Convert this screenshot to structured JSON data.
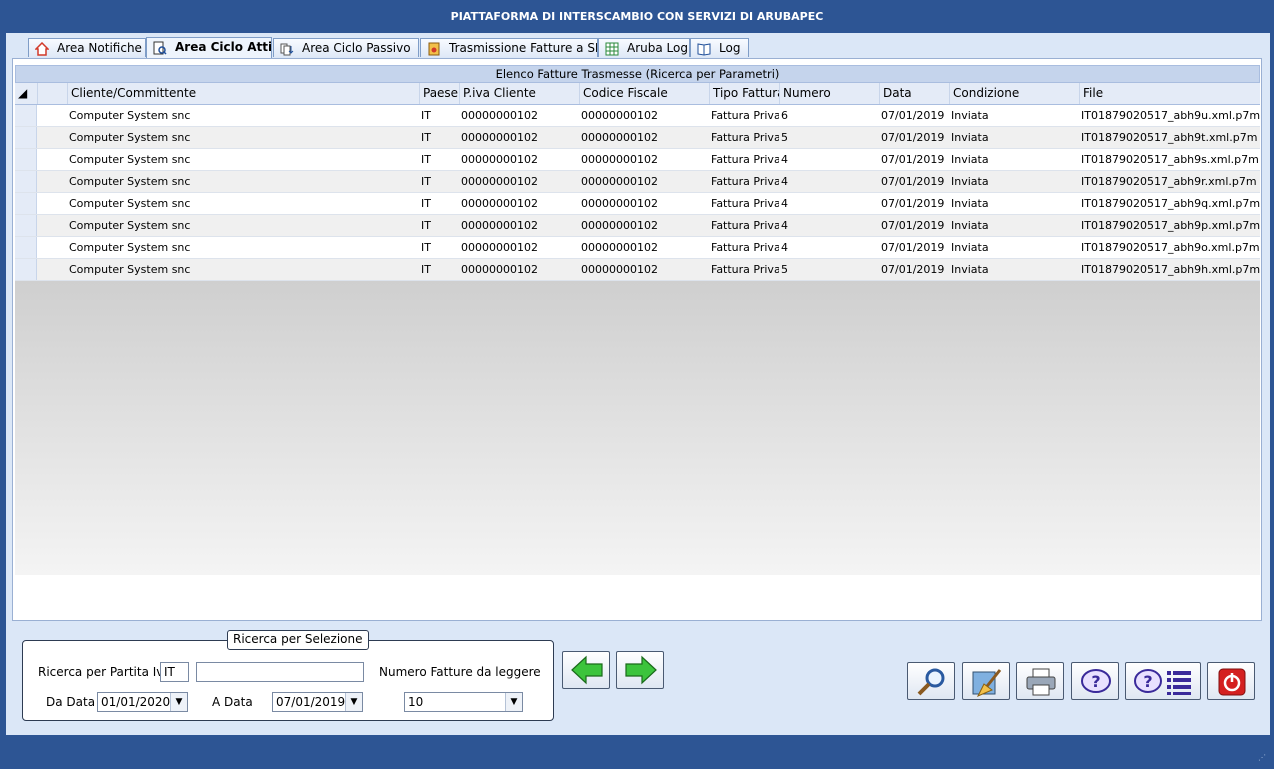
{
  "window": {
    "title": "PIATTAFORMA DI INTERSCAMBIO CON SERVIZI DI ARUBAPEC"
  },
  "tabs": [
    {
      "label": "Area Notifiche",
      "icon": "home-icon"
    },
    {
      "label": "Area Ciclo Attivo",
      "icon": "document-search-icon"
    },
    {
      "label": "Area Ciclo Passivo",
      "icon": "documents-arrow-icon"
    },
    {
      "label": "Trasmissione Fatture a SDI",
      "icon": "certificate-icon"
    },
    {
      "label": "Aruba Log",
      "icon": "table-icon"
    },
    {
      "label": "Log",
      "icon": "book-icon"
    }
  ],
  "grid": {
    "title": "Elenco Fatture Trasmesse (Ricerca per Parametri)",
    "columns": [
      "Cliente/Committente",
      "Paese",
      "P.iva Cliente",
      "Codice Fiscale",
      "Tipo Fattura",
      "Numero",
      "Data",
      "Condizione",
      "File"
    ],
    "rows": [
      [
        "Computer System snc",
        "IT",
        "00000000102",
        "00000000102",
        "Fattura Privati",
        "6",
        "07/01/2019",
        "Inviata",
        "IT01879020517_abh9u.xml.p7m"
      ],
      [
        "Computer System snc",
        "IT",
        "00000000102",
        "00000000102",
        "Fattura Privati",
        "5",
        "07/01/2019",
        "Inviata",
        "IT01879020517_abh9t.xml.p7m"
      ],
      [
        "Computer System snc",
        "IT",
        "00000000102",
        "00000000102",
        "Fattura Privati",
        "4",
        "07/01/2019",
        "Inviata",
        "IT01879020517_abh9s.xml.p7m"
      ],
      [
        "Computer System snc",
        "IT",
        "00000000102",
        "00000000102",
        "Fattura Privati",
        "4",
        "07/01/2019",
        "Inviata",
        "IT01879020517_abh9r.xml.p7m"
      ],
      [
        "Computer System snc",
        "IT",
        "00000000102",
        "00000000102",
        "Fattura Privati",
        "4",
        "07/01/2019",
        "Inviata",
        "IT01879020517_abh9q.xml.p7m"
      ],
      [
        "Computer System snc",
        "IT",
        "00000000102",
        "00000000102",
        "Fattura Privati",
        "4",
        "07/01/2019",
        "Inviata",
        "IT01879020517_abh9p.xml.p7m"
      ],
      [
        "Computer System snc",
        "IT",
        "00000000102",
        "00000000102",
        "Fattura Privati",
        "4",
        "07/01/2019",
        "Inviata",
        "IT01879020517_abh9o.xml.p7m"
      ],
      [
        "Computer System snc",
        "IT",
        "00000000102",
        "00000000102",
        "Fattura Privati",
        "5",
        "07/01/2019",
        "Inviata",
        "IT01879020517_abh9h.xml.p7m"
      ]
    ]
  },
  "search": {
    "legend": "Ricerca per Selezione",
    "piva_label": "Ricerca per Partita Iva",
    "country_value": "IT",
    "piva_value": "",
    "count_label": "Numero Fatture da leggere",
    "count_value": "10",
    "from_label": "Da Data",
    "from_value": "01/01/2020",
    "to_label": "A Data",
    "to_value": "07/01/2019"
  },
  "toolbar": {
    "buttons": [
      "search-icon",
      "broom-icon",
      "printer-icon",
      "help-icon",
      "help-list-icon",
      "power-icon"
    ]
  },
  "colors": {
    "titlebar": "#2d5594",
    "client": "#dbe7f7",
    "accent_green": "#2db52d",
    "power_red": "#d42020"
  }
}
